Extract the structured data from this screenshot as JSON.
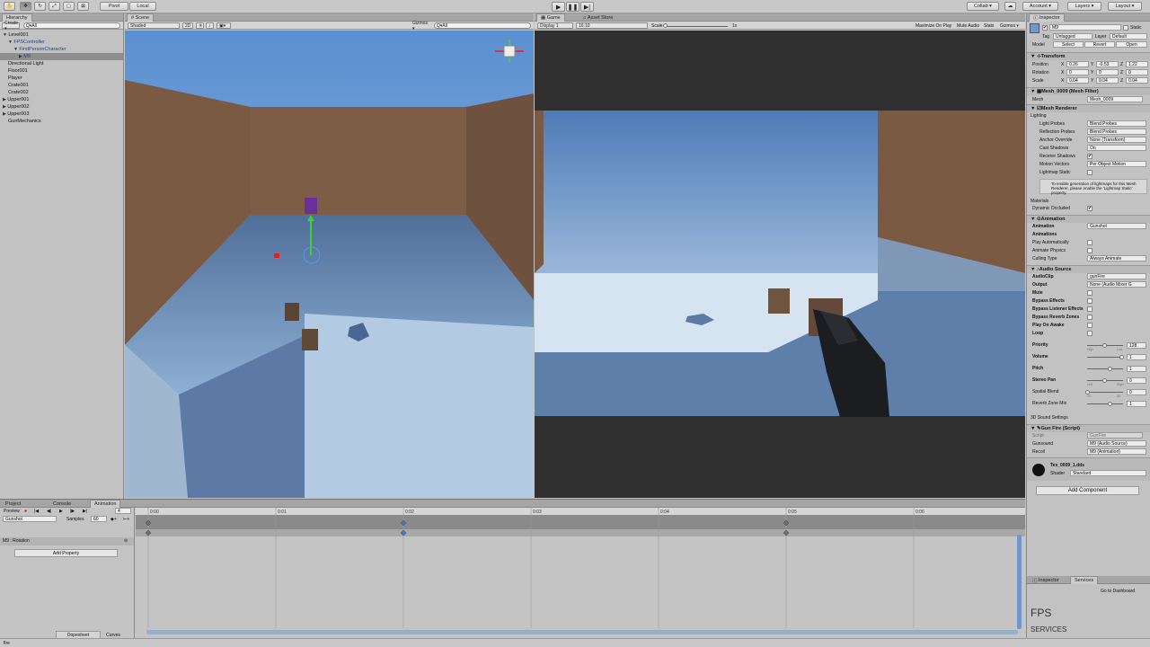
{
  "toolbar": {
    "pivot": "Pivot",
    "local": "Local",
    "collab": "Collab ▾",
    "account": "Account ▾",
    "layers": "Layers ▾",
    "layout": "Layout ▾",
    "play_icon": "play-icon",
    "pause_icon": "pause-icon",
    "step_icon": "step-icon"
  },
  "hierarchy": {
    "tab": "Hierarchy",
    "create": "Create ▾",
    "search_placeholder": "Q▾All",
    "items": [
      {
        "label": "Level001",
        "indent": 0,
        "arrow": "▼"
      },
      {
        "label": "FPSController",
        "indent": 1,
        "arrow": "▼",
        "blue": true
      },
      {
        "label": "FirstPersonCharacter",
        "indent": 2,
        "arrow": "▼",
        "blue": true
      },
      {
        "label": "M9",
        "indent": 3,
        "arrow": "▶",
        "blue": true,
        "selected": true
      },
      {
        "label": "Directional Light",
        "indent": 1,
        "arrow": ""
      },
      {
        "label": "Floor001",
        "indent": 1,
        "arrow": ""
      },
      {
        "label": "Player",
        "indent": 1,
        "arrow": ""
      },
      {
        "label": "Crate001",
        "indent": 1,
        "arrow": ""
      },
      {
        "label": "Crate002",
        "indent": 1,
        "arrow": ""
      },
      {
        "label": "Upper001",
        "indent": 0,
        "arrow": "▶"
      },
      {
        "label": "Upper002",
        "indent": 0,
        "arrow": "▶"
      },
      {
        "label": "Upper003",
        "indent": 0,
        "arrow": "▶"
      },
      {
        "label": "GunMechanics",
        "indent": 1,
        "arrow": ""
      }
    ]
  },
  "scene": {
    "tab": "Scene",
    "shaded": "Shaded",
    "mode_2d": "2D",
    "gizmos": "Gizmos ▾",
    "search": "Q▾All"
  },
  "game": {
    "tab": "Game",
    "store_tab": "Asset Store",
    "display": "Display 1",
    "aspect": "16:10",
    "scale_label": "Scale",
    "scale_value": "1x",
    "toggles": [
      "Maximize On Play",
      "Mute Audio",
      "Stats",
      "Gizmos ▾"
    ]
  },
  "inspector": {
    "tab": "Inspector",
    "name": "M9",
    "static": "Static",
    "tag_label": "Tag",
    "tag": "Untagged",
    "layer_label": "Layer",
    "layer": "Default",
    "model_label": "Model",
    "select": "Select",
    "revert": "Revert",
    "open": "Open",
    "transform": {
      "title": "Transform",
      "position": "Position",
      "rotation": "Rotation",
      "scale": "Scale",
      "pos": [
        "0.26",
        "-0.53",
        "1.22"
      ],
      "rot": [
        "0",
        "0",
        "0"
      ],
      "scl": [
        "0.04",
        "0.04",
        "0.04"
      ],
      "axes": [
        "X",
        "Y",
        "Z"
      ]
    },
    "mesh_filter": {
      "title": "Mesh_0009 (Mesh Filter)",
      "mesh_label": "Mesh",
      "mesh": "Mesh_0009"
    },
    "mesh_renderer": {
      "title": "Mesh Renderer",
      "lighting": "Lighting",
      "rows": [
        {
          "label": "Light Probes",
          "value": "Blend Probes"
        },
        {
          "label": "Reflection Probes",
          "value": "Blend Probes"
        },
        {
          "label": "Anchor Override",
          "value": "None (Transform)"
        },
        {
          "label": "Cast Shadows",
          "value": "On"
        },
        {
          "label": "Receive Shadows",
          "value": "✔"
        },
        {
          "label": "Motion Vectors",
          "value": "Per Object Motion"
        },
        {
          "label": "Lightmap Static",
          "value": ""
        }
      ],
      "info": "To enable generation of lightmaps for this Mesh Renderer, please enable the 'Lightmap Static' property.",
      "materials": "Materials",
      "dynamic_occluded": "Dynamic Occluded"
    },
    "animation": {
      "title": "Animation",
      "rows": [
        {
          "label": "Animation",
          "value": "Gunshot"
        },
        {
          "label": "Animations",
          "value": ""
        },
        {
          "label": "Play Automatically",
          "value": ""
        },
        {
          "label": "Animate Physics",
          "value": ""
        },
        {
          "label": "Culling Type",
          "value": "Always Animate"
        }
      ]
    },
    "audio": {
      "title": "Audio Source",
      "rows": [
        {
          "label": "AudioClip",
          "value": "gunFire"
        },
        {
          "label": "Output",
          "value": "None (Audio Mixer G"
        },
        {
          "label": "Mute",
          "value": ""
        },
        {
          "label": "Bypass Effects",
          "value": ""
        },
        {
          "label": "Bypass Listener Effects",
          "value": ""
        },
        {
          "label": "Bypass Reverb Zones",
          "value": ""
        },
        {
          "label": "Play On Awake",
          "value": ""
        },
        {
          "label": "Loop",
          "value": ""
        }
      ],
      "priority": "Priority",
      "priority_val": "128",
      "high": "High",
      "low": "Low",
      "volume": "Volume",
      "volume_val": "1",
      "pitch": "Pitch",
      "pitch_val": "1",
      "stereo": "Stereo Pan",
      "stereo_val": "0",
      "left": "Left",
      "right": "Right",
      "spatial": "Spatial Blend",
      "spatial_val": "0",
      "d2": "2D",
      "d3": "3D",
      "reverb": "Reverb Zone Mix",
      "reverb_val": "1",
      "sound3d": "3D Sound Settings",
      "priority_frac": 0.5,
      "volume_frac": 1.0,
      "pitch_frac": 0.67,
      "stereo_frac": 0.5,
      "spatial_frac": 0.0,
      "reverb_frac": 0.67
    },
    "gunfire": {
      "title": "Gun Fire (Script)",
      "script_label": "Script",
      "script": "GunFire",
      "gunsound_label": "Gunsound",
      "gunsound": "M9 (Audio Source)",
      "recoil_label": "Recoil",
      "recoil": "M9 (Animation)"
    },
    "material": {
      "name": "Tex_0009_1.dds",
      "shader_label": "Shader",
      "shader": "Standard"
    },
    "add_component": "Add Component"
  },
  "services": {
    "tab1": "Inspector",
    "tab2": "Services",
    "dashboard": "Go to Dashboard",
    "fps": "FPS",
    "services_label": "SERVICES"
  },
  "animation": {
    "tabs": [
      "Project",
      "Console",
      "Animation"
    ],
    "preview": "Preview",
    "clip": "Gunshot",
    "samples_label": "Samples",
    "samples": "60",
    "frame": "4",
    "property": "M9 : Rotation",
    "add_property": "Add Property",
    "bottom_tabs": [
      "Dopesheet",
      "Curves"
    ],
    "timeline": [
      "0:00",
      "0:01",
      "0:02",
      "0:03",
      "0:04",
      "0:05",
      "0:06"
    ]
  },
  "status": {
    "text": "fire"
  }
}
